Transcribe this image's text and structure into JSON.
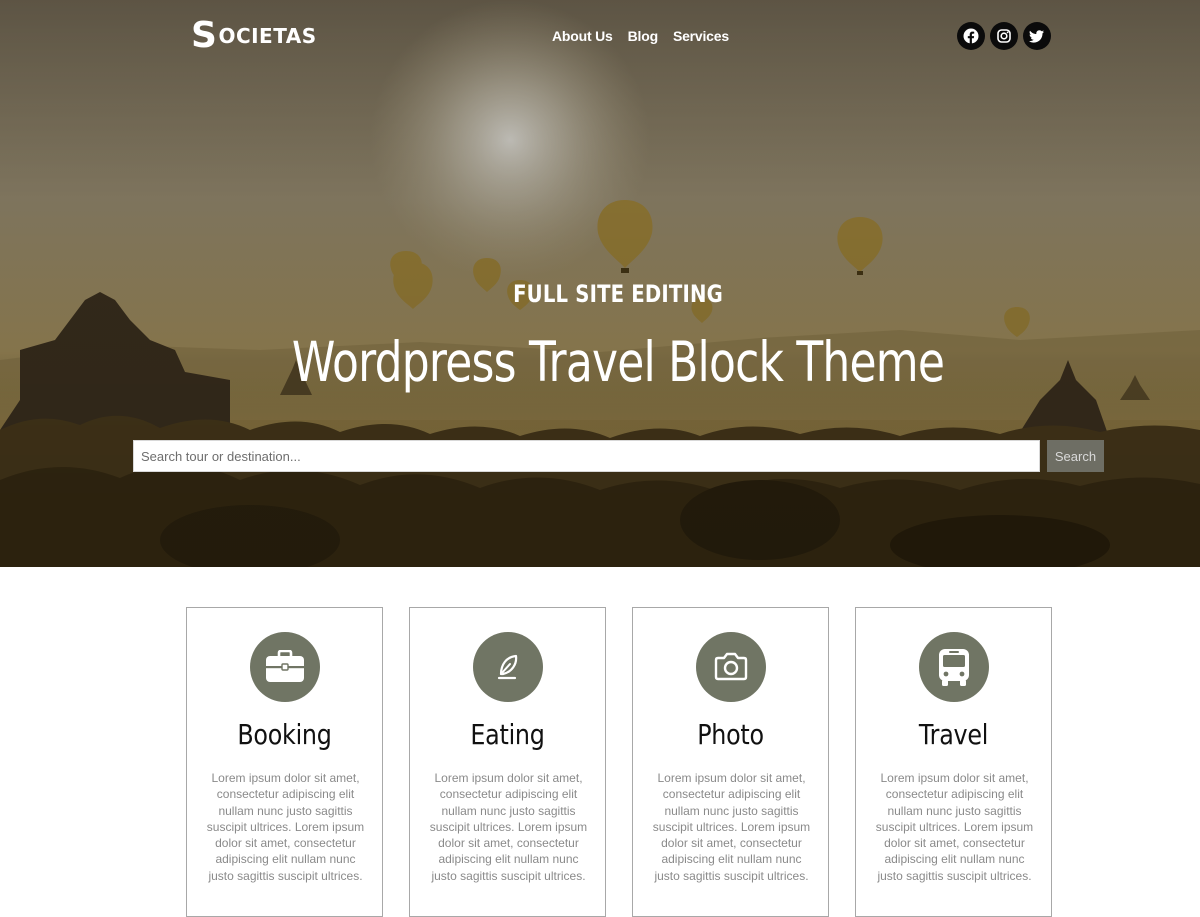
{
  "header": {
    "logo_first_letter": "S",
    "logo_rest": "OCIETAS",
    "nav": [
      "About Us",
      "Blog",
      "Services"
    ],
    "social": [
      "facebook-icon",
      "instagram-icon",
      "twitter-icon"
    ]
  },
  "hero": {
    "kicker": "FULL SITE EDITING",
    "title": "Wordpress Travel Block Theme",
    "search": {
      "placeholder": "Search tour or destination...",
      "value": "",
      "button_label": "Search"
    }
  },
  "features": {
    "icon_color": "#707564",
    "cards": [
      {
        "icon": "briefcase-icon",
        "title": "Booking",
        "text": "Lorem ipsum dolor sit amet, consectetur adipiscing elit nullam nunc justo sagittis suscipit ultrices. Lorem ipsum dolor sit amet, consectetur adipiscing elit nullam nunc justo sagittis suscipit ultrices."
      },
      {
        "icon": "feather-icon",
        "title": "Eating",
        "text": "Lorem ipsum dolor sit amet, consectetur adipiscing elit nullam nunc justo sagittis suscipit ultrices. Lorem ipsum dolor sit amet, consectetur adipiscing elit nullam nunc justo sagittis suscipit ultrices."
      },
      {
        "icon": "camera-icon",
        "title": "Photo",
        "text": "Lorem ipsum dolor sit amet, consectetur adipiscing elit nullam nunc justo sagittis suscipit ultrices. Lorem ipsum dolor sit amet, consectetur adipiscing elit nullam nunc justo sagittis suscipit ultrices."
      },
      {
        "icon": "bus-icon",
        "title": "Travel",
        "text": "Lorem ipsum dolor sit amet, consectetur adipiscing elit nullam nunc justo sagittis suscipit ultrices. Lorem ipsum dolor sit amet, consectetur adipiscing elit nullam nunc justo sagittis suscipit ultrices."
      }
    ]
  }
}
